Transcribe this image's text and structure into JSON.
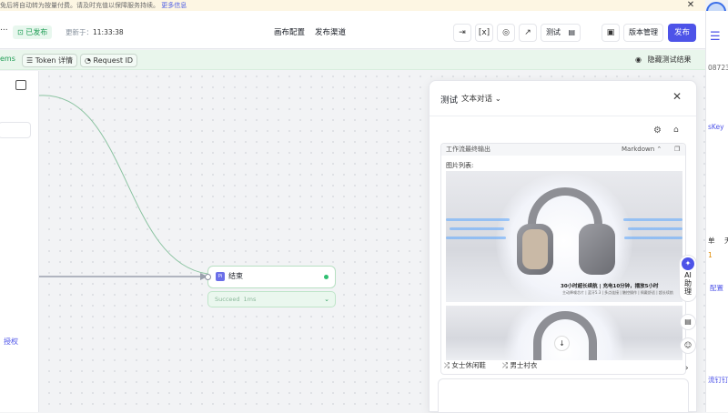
{
  "notice": {
    "text": "免后将自动转为按量付费。请及时充值以保障服务持续。",
    "link": "更多信息"
  },
  "header": {
    "dots": "...",
    "status": "已发布",
    "updated_label": "更新于：",
    "updated_time": "11:33:38",
    "tabs": [
      "画布配置",
      "发布渠道"
    ],
    "test_label": "测试",
    "version_label": "版本管理",
    "publish_label": "发布"
  },
  "debug": {
    "items_text": "ems",
    "token_label": "Token 详情",
    "request_label": "Request ID",
    "hide_label": "隐藏测试结果"
  },
  "left_panel": {
    "auth_label": "授权"
  },
  "end_node": {
    "label": "结束",
    "icon_text": "Pi",
    "status": "Succeed",
    "duration": "1ms"
  },
  "test_panel": {
    "title": "测试",
    "mode": "文本对话",
    "output_label": "工作流最终输出",
    "format": "Markdown",
    "image_list_label": "图片列表:",
    "caption_main": "30小时超长续航 | 充电10分钟，播放5小时",
    "caption_sub": "主动降噪芯片 | 蓝牙5.3 | 多点连接 | 触控操作 | 佩戴舒适 | 超长续航",
    "suggestions": [
      "女士休闲鞋",
      "男士衬衣"
    ]
  },
  "ai_assistant": {
    "line1": "AI",
    "line2": "助",
    "line3": "理"
  },
  "right_strip": {
    "texts": [
      "08723",
      "sKey",
      "单",
      "天",
      "1",
      "配置",
      "流钉钉"
    ]
  },
  "colors": {
    "accent": "#4d53e8",
    "success": "#1f9d55",
    "debug_bg": "#e9f6ec"
  },
  "icons": [
    "close-icon",
    "export-icon",
    "variable-icon",
    "settings-icon",
    "trend-icon",
    "doc-icon",
    "save-icon",
    "database-icon",
    "clock-icon",
    "eye-icon",
    "sidebar-icon",
    "trash-icon",
    "copy-icon",
    "arrow-down-icon",
    "chevron-right-icon",
    "star-icon",
    "emoji-icon"
  ]
}
